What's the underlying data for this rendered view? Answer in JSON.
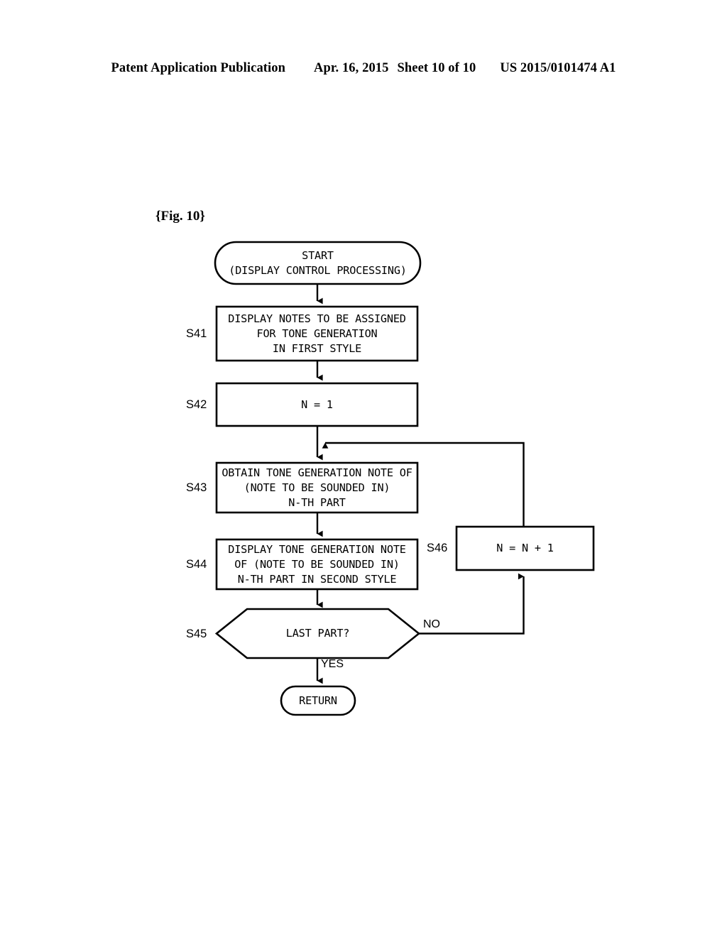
{
  "header": {
    "publication": "Patent Application Publication",
    "date": "Apr. 16, 2015",
    "sheet": "Sheet 10 of 10",
    "docnumber": "US 2015/0101474 A1"
  },
  "figure": {
    "label": "{Fig. 10}"
  },
  "diagram": {
    "title": "Display control processing flowchart",
    "nodes": {
      "start": {
        "shape": "stadium",
        "line1": "START",
        "line2": "(DISPLAY CONTROL PROCESSING)"
      },
      "s41": {
        "shape": "rect",
        "step": "S41",
        "line1": "DISPLAY NOTES TO BE ASSIGNED",
        "line2": "FOR TONE GENERATION",
        "line3": "IN FIRST STYLE"
      },
      "s42": {
        "shape": "rect",
        "step": "S42",
        "line1": "N = 1"
      },
      "s43": {
        "shape": "rect",
        "step": "S43",
        "line1": "OBTAIN TONE GENERATION NOTE OF",
        "line2": "(NOTE TO BE SOUNDED IN)",
        "line3": "N-TH PART"
      },
      "s44": {
        "shape": "rect",
        "step": "S44",
        "line1": "DISPLAY TONE GENERATION NOTE",
        "line2": "OF (NOTE TO BE SOUNDED IN)",
        "line3": "N-TH PART IN SECOND STYLE"
      },
      "s45": {
        "shape": "hexagon",
        "step": "S45",
        "line1": "LAST PART?"
      },
      "s46": {
        "shape": "rect",
        "step": "S46",
        "line1": "N = N + 1"
      },
      "return": {
        "shape": "stadium",
        "line1": "RETURN"
      }
    },
    "edges": {
      "yes": "YES",
      "no": "NO"
    },
    "colors": {
      "stroke": "#000000",
      "fill": "#ffffff",
      "background": "#ffffff"
    }
  }
}
